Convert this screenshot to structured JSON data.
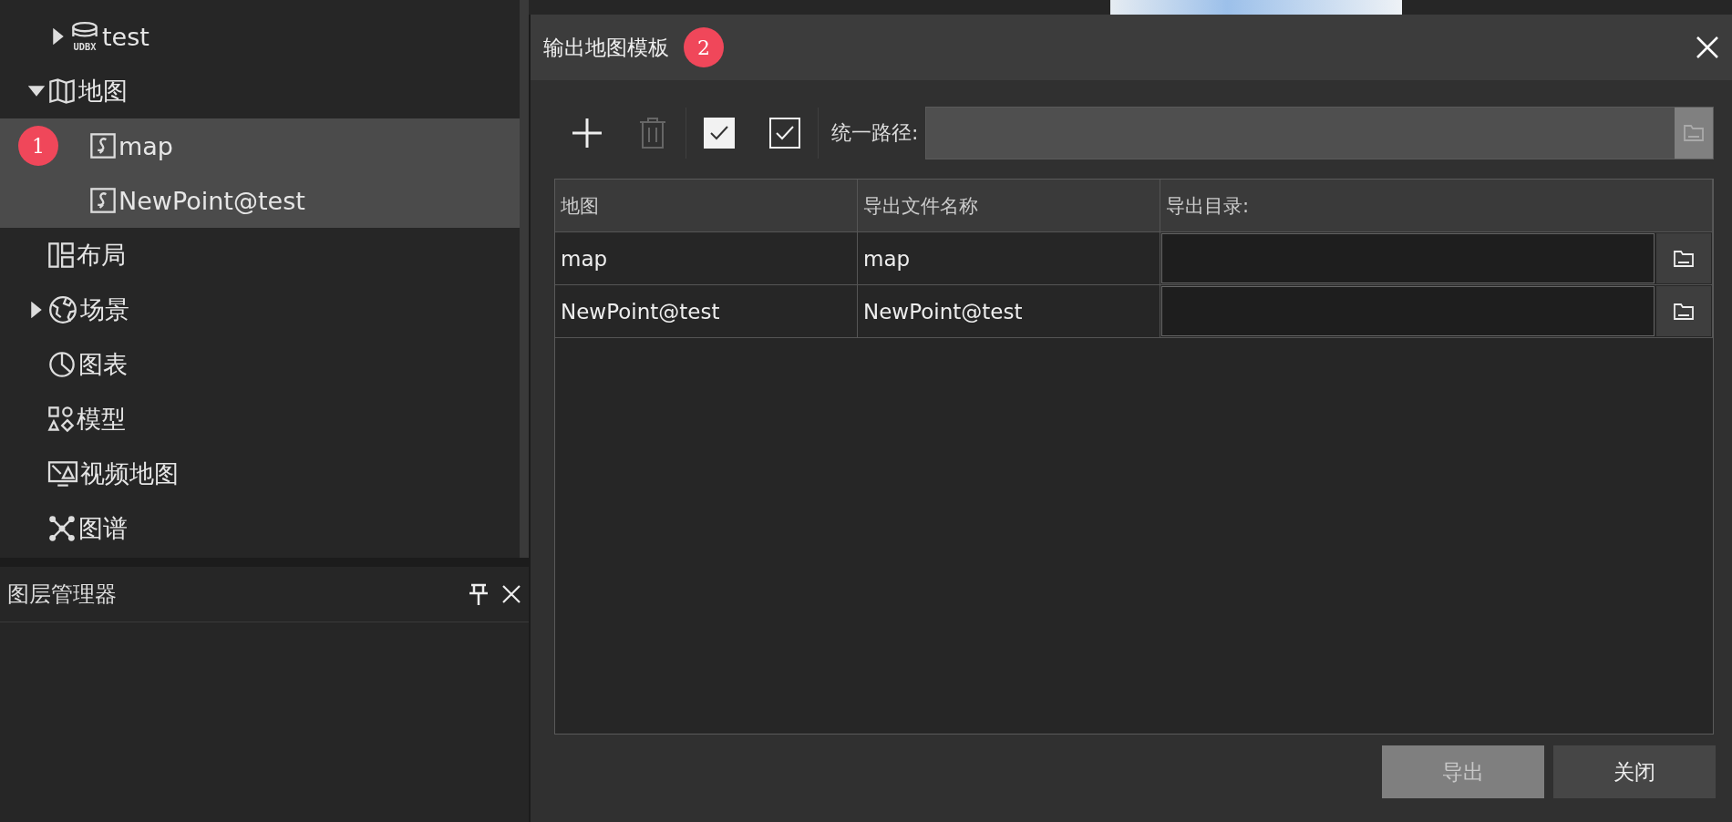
{
  "workspace_tree": {
    "datasources": [
      {
        "label": "test",
        "kind": "udbx",
        "icon_text": "UDBX",
        "expanded": false,
        "selected": false
      }
    ],
    "items": [
      {
        "label": "地图",
        "kind": "map",
        "expanded": true,
        "selected": false,
        "children": [
          {
            "label": "map",
            "kind": "map-doc",
            "selected": true,
            "marker": "1"
          },
          {
            "label": "NewPoint@test",
            "kind": "map-doc",
            "selected": true
          }
        ]
      },
      {
        "label": "布局",
        "kind": "layout",
        "selected": false
      },
      {
        "label": "场景",
        "kind": "globe",
        "expanded": false,
        "selected": false
      },
      {
        "label": "图表",
        "kind": "pie",
        "selected": false
      },
      {
        "label": "模型",
        "kind": "shapes",
        "selected": false
      },
      {
        "label": "视频地图",
        "kind": "video",
        "selected": false
      },
      {
        "label": "图谱",
        "kind": "graph",
        "selected": false
      }
    ]
  },
  "layer_panel": {
    "title": "图层管理器"
  },
  "dialog": {
    "title": "输出地图模板",
    "title_marker": "2",
    "toolbar": [
      {
        "kind": "add",
        "disabled": false
      },
      {
        "kind": "delete",
        "disabled": true
      },
      {
        "kind": "check-filled",
        "checked": true
      },
      {
        "kind": "check-outline",
        "checked": true
      }
    ],
    "path": {
      "label": "统一路径:",
      "disabled": true
    },
    "table": {
      "columns": [
        "地图",
        "导出文件名称",
        "导出目录:"
      ],
      "rows": [
        {
          "map": "map",
          "file_name": "map"
        },
        {
          "map": "NewPoint@test",
          "file_name": "NewPoint@test"
        }
      ]
    },
    "buttons": [
      {
        "label": "导出",
        "disabled": true
      },
      {
        "label": "关闭",
        "disabled": false
      }
    ]
  }
}
